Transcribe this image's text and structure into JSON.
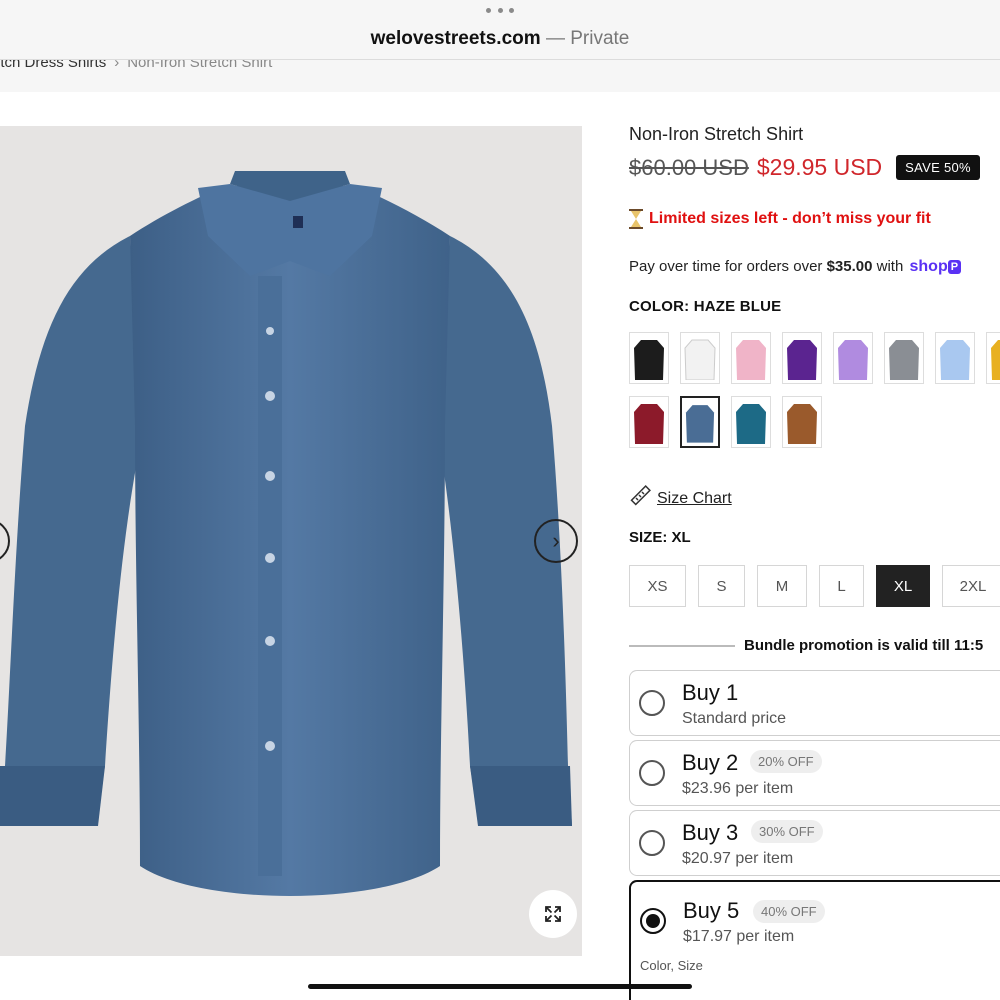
{
  "browser": {
    "host": "welovestreets.com",
    "separator": "—",
    "mode": "Private"
  },
  "breadcrumb": {
    "parent": "etch Dress Shirts",
    "current": "Non-Iron Stretch Shirt"
  },
  "product": {
    "title": "Non-Iron Stretch Shirt",
    "old_price": "$60.00 USD",
    "new_price": "$29.95 USD",
    "save_badge": "SAVE 50%",
    "urgency": "Limited sizes left - don’t miss your fit",
    "pay_text": "Pay over time for orders over",
    "pay_amount": "$35.00",
    "pay_with": "with",
    "shop_brand": "shop",
    "shop_pay": "P",
    "color_label": "COLOR: HAZE BLUE",
    "size_chart": "Size Chart",
    "size_label": "SIZE: XL"
  },
  "colors": {
    "selected_shirt": "#4a6d95",
    "price_red": "#d0262b",
    "shop_purple": "#5a31f4",
    "swatches": [
      "#1c1c1c",
      "#f2f2f2",
      "#f0b4c8",
      "#5b2490",
      "#b08be0",
      "#8a8e94",
      "#a9c8f0",
      "#e8b020",
      "#8c1a2a",
      "#4a6d95",
      "#1d6a86",
      "#9a5a2c"
    ]
  },
  "sizes": [
    "XS",
    "S",
    "M",
    "L",
    "XL",
    "2XL"
  ],
  "bundle": {
    "heading": "Bundle promotion is valid till 11:5",
    "options": [
      {
        "title": "Buy 1",
        "subtitle": "Standard price",
        "badge": ""
      },
      {
        "title": "Buy 2",
        "subtitle": "$23.96 per item",
        "badge": "20% OFF"
      },
      {
        "title": "Buy 3",
        "subtitle": "$20.97 per item",
        "badge": "30% OFF"
      },
      {
        "title": "Buy 5",
        "subtitle": "$17.97 per item",
        "badge": "40% OFF",
        "extra": "Color, Size"
      }
    ]
  },
  "icons": {
    "prev": "chevron-left-icon",
    "next": "chevron-right-icon",
    "zoom": "expand-icon",
    "ruler": "ruler-icon",
    "hourglass": "hourglass-icon"
  }
}
